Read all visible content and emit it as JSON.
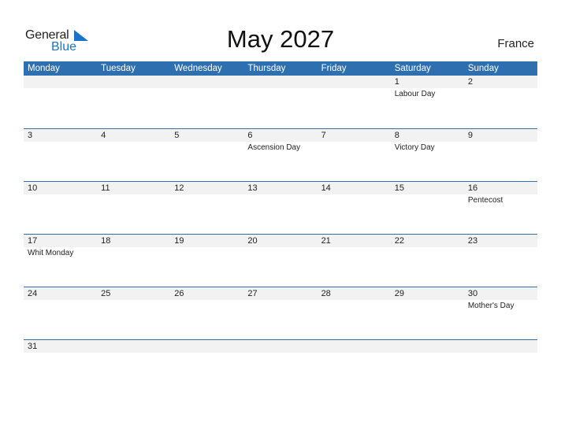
{
  "brand": {
    "part1": "General",
    "part2": "Blue",
    "accent": "#1a73c8"
  },
  "title": "May 2027",
  "country": "France",
  "header_color": "#2e6fb0",
  "weekdays": [
    "Monday",
    "Tuesday",
    "Wednesday",
    "Thursday",
    "Friday",
    "Saturday",
    "Sunday"
  ],
  "weeks": [
    {
      "days": [
        "",
        "",
        "",
        "",
        "",
        "1",
        "2"
      ],
      "events": [
        "",
        "",
        "",
        "",
        "",
        "Labour Day",
        ""
      ]
    },
    {
      "days": [
        "3",
        "4",
        "5",
        "6",
        "7",
        "8",
        "9"
      ],
      "events": [
        "",
        "",
        "",
        "Ascension Day",
        "",
        "Victory Day",
        ""
      ]
    },
    {
      "days": [
        "10",
        "11",
        "12",
        "13",
        "14",
        "15",
        "16"
      ],
      "events": [
        "",
        "",
        "",
        "",
        "",
        "",
        "Pentecost"
      ]
    },
    {
      "days": [
        "17",
        "18",
        "19",
        "20",
        "21",
        "22",
        "23"
      ],
      "events": [
        "Whit Monday",
        "",
        "",
        "",
        "",
        "",
        ""
      ]
    },
    {
      "days": [
        "24",
        "25",
        "26",
        "27",
        "28",
        "29",
        "30"
      ],
      "events": [
        "",
        "",
        "",
        "",
        "",
        "",
        "Mother's Day"
      ]
    },
    {
      "days": [
        "31",
        "",
        "",
        "",
        "",
        "",
        ""
      ],
      "events": [
        "",
        "",
        "",
        "",
        "",
        "",
        ""
      ]
    }
  ]
}
